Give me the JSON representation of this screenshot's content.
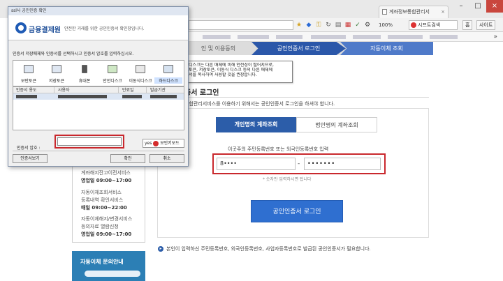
{
  "browser": {
    "tab_title": "계좌정보통합관리서",
    "tab_close": "×",
    "win_min": "–",
    "win_max": "□",
    "win_close": "×",
    "zoom": "100%",
    "search_label": "시프트검색",
    "button_home": "홈",
    "button_sites": "사이트",
    "more_glyph": "»"
  },
  "steps": {
    "step1": "인 및 이용동의",
    "step2": "공인인증서 로그인",
    "step3": "자동이체 조회"
  },
  "tooltip": {
    "lines": [
      "하드디스크는 다른 매체에 비해 안전성이 떨어지므로,",
      "보안토큰, 저장토큰, 이동식 디스크 등의 다른 매체에",
      "인증서를 복사하여 사용할 것을 권장합니다."
    ]
  },
  "left_panel": {
    "services": [
      "계좌해지잔고이전서비스",
      "영업일 09:00~17:00",
      "자동이체조회서비스",
      "등록내역 확인서비스",
      "매일 09:00~22:00",
      "자동이체해지/변경서비스",
      "등의자료 열람신청",
      "영업일 09:00~17:00"
    ],
    "nav_title": "자동이체 문의안내"
  },
  "login": {
    "title": "증서 로그인",
    "desc": "통합관리서비스를 이용하기 위해서는 공인인증서 로그인을 하셔야 합니다.",
    "tab_personal": "개인명의 계좌조회",
    "tab_corporate": "법인명의 계좌조회",
    "id_label": "이곳주의 주민등록번호 또는 외국인등록번호 입력",
    "id_front": "8••••",
    "id_dash": "-",
    "id_back": "•••••••",
    "id_hint": "* 숫자만 입력하시면 됩니다",
    "button": "공인인증서 로그인",
    "footnote": "본인이 입력하신 주민등록번호, 외국인등록번호, 사업자등록번호로 발급된 공인인증서가 필요합니다."
  },
  "dialog": {
    "title_bar": "ssl사 공인인증 확인",
    "logo": "금융결제원",
    "header_sub": "안전한 거래를 위한 공인인증서 확인창입니다.",
    "instruction": "인증서 저장매체와 인증서를 선택하시고 인증서 암호를 입력하십시오.",
    "locations": [
      "보안토큰",
      "저장토큰",
      "휴대폰",
      "안전디스크",
      "이동식디스크",
      "하드디스크"
    ],
    "columns": [
      "인증서 용도",
      "사용자",
      "만료일",
      "발급기관"
    ],
    "password_label": "인증서 암호 :",
    "keyboard_badge": "yes",
    "keyboard_text": "보안키보드",
    "buttons": {
      "view": "인증서보기",
      "ok": "확인",
      "cancel": "취소"
    }
  },
  "colors": {
    "primary": "#2c5da9",
    "highlight": "#c9282d",
    "button": "#2f6fd0"
  }
}
